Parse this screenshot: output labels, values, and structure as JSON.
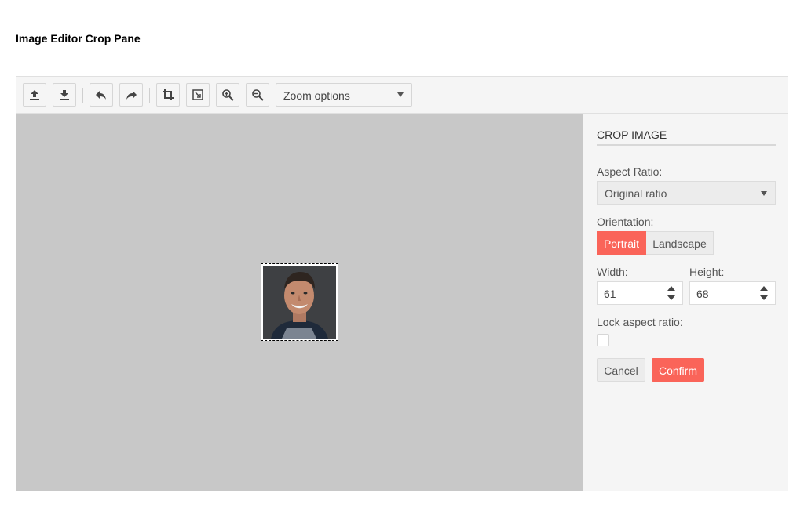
{
  "page": {
    "title": "Image Editor Crop Pane"
  },
  "toolbar": {
    "icons": [
      "upload-icon",
      "download-icon",
      "undo-icon",
      "redo-icon",
      "crop-icon",
      "reset-icon",
      "zoom-in-icon",
      "zoom-out-icon"
    ],
    "zoom_placeholder": "Zoom options"
  },
  "panel": {
    "title": "CROP IMAGE",
    "aspect_ratio_label": "Aspect Ratio:",
    "aspect_ratio_value": "Original ratio",
    "orientation_label": "Orientation:",
    "orientation_options": [
      "Portrait",
      "Landscape"
    ],
    "orientation_selected": "Portrait",
    "width_label": "Width:",
    "width_value": "61",
    "height_label": "Height:",
    "height_value": "68",
    "lock_label": "Lock aspect ratio:",
    "lock_checked": false,
    "cancel_label": "Cancel",
    "confirm_label": "Confirm"
  },
  "colors": {
    "accent": "#fa6459",
    "canvas": "#c8c8c8",
    "panel": "#f5f5f5"
  }
}
